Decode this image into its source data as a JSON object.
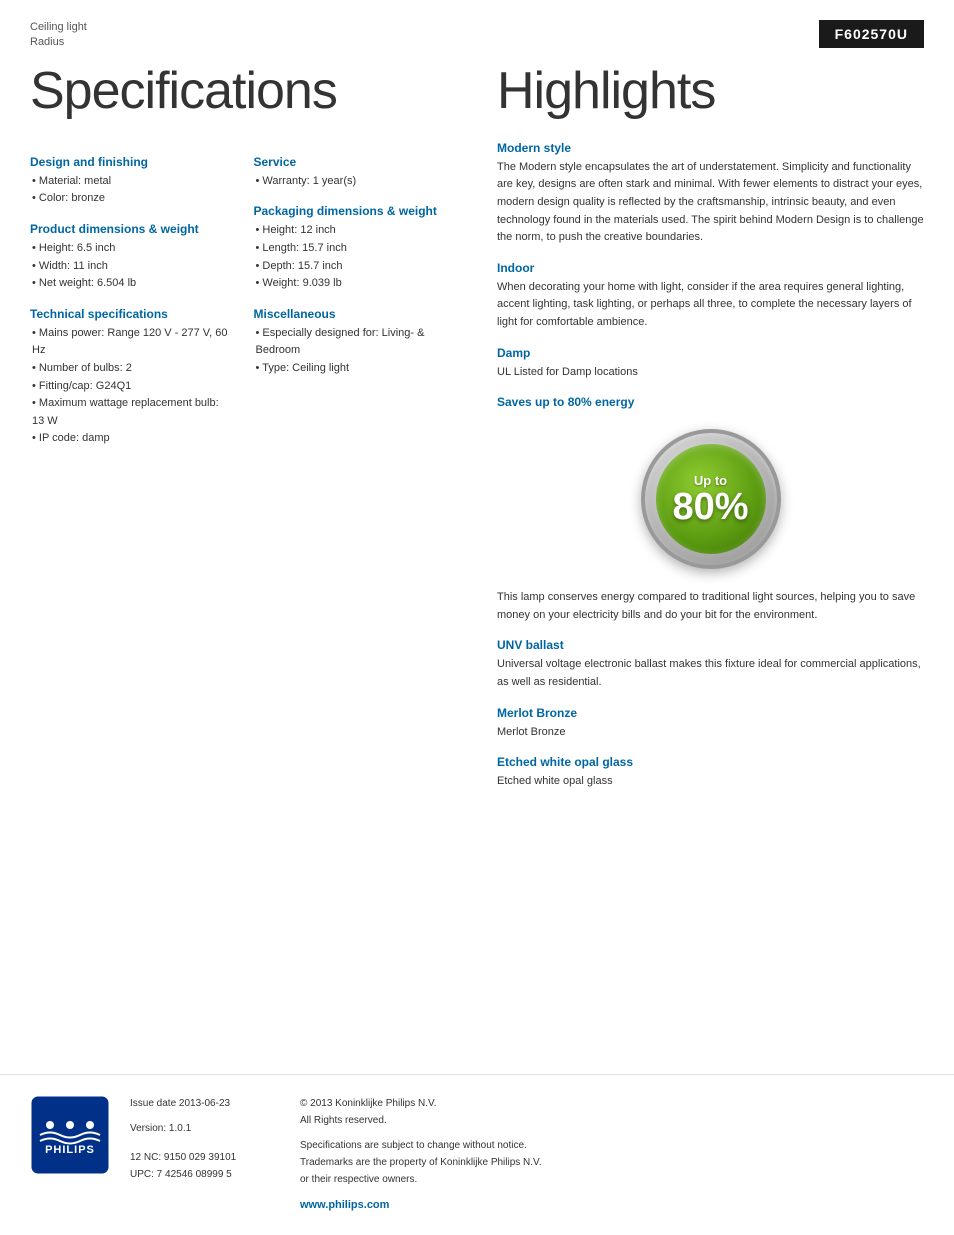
{
  "header": {
    "product_type": "Ceiling light",
    "product_name": "Radius",
    "product_code": "F602570U"
  },
  "specs_title": "Specifications",
  "highlights_title": "Highlights",
  "sections": {
    "design_finishing": {
      "heading": "Design and finishing",
      "items": [
        "Material: metal",
        "Color: bronze"
      ]
    },
    "product_dimensions": {
      "heading": "Product dimensions & weight",
      "items": [
        "Height: 6.5 inch",
        "Width: 11 inch",
        "Net weight: 6.504 lb"
      ]
    },
    "technical_specifications": {
      "heading": "Technical specifications",
      "items": [
        "Mains power: Range 120 V - 277 V, 60 Hz",
        "Number of bulbs: 2",
        "Fitting/cap: G24Q1",
        "Maximum wattage replacement bulb: 13 W",
        "IP code: damp"
      ]
    },
    "service": {
      "heading": "Service",
      "items": [
        "Warranty: 1 year(s)"
      ]
    },
    "packaging_dimensions": {
      "heading": "Packaging dimensions & weight",
      "items": [
        "Height: 12 inch",
        "Length: 15.7 inch",
        "Depth: 15.7 inch",
        "Weight: 9.039 lb"
      ]
    },
    "miscellaneous": {
      "heading": "Miscellaneous",
      "items": [
        "Especially designed for: Living- & Bedroom",
        "Type: Ceiling light"
      ]
    }
  },
  "highlights": {
    "modern_style": {
      "heading": "Modern style",
      "text": "The Modern style encapsulates the art of understatement. Simplicity and functionality are key, designs are often stark and minimal. With fewer elements to distract your eyes, modern design quality is reflected by the craftsmanship, intrinsic beauty, and even technology found in the materials used. The spirit behind Modern Design is to challenge the norm, to push the creative boundaries."
    },
    "indoor": {
      "heading": "Indoor",
      "text": "When decorating your home with light, consider if the area requires general lighting, accent lighting, task lighting, or perhaps all three, to complete the necessary layers of light for comfortable ambience."
    },
    "damp": {
      "heading": "Damp",
      "text": "UL Listed for Damp locations"
    },
    "saves_energy": {
      "heading": "Saves up to 80% energy",
      "badge_up_to": "Up to",
      "badge_percent": "80%"
    },
    "energy_text": "This lamp conserves energy compared to traditional light sources, helping you to save money on your electricity bills and do your bit for the environment.",
    "unv_ballast": {
      "heading": "UNV ballast",
      "text": "Universal voltage electronic ballast makes this fixture ideal for commercial applications, as well as residential."
    },
    "merlot_bronze": {
      "heading": "Merlot Bronze",
      "text": "Merlot Bronze"
    },
    "etched_glass": {
      "heading": "Etched white opal glass",
      "text": "Etched white opal glass"
    }
  },
  "footer": {
    "issue_date_label": "Issue date 2013-06-23",
    "version_label": "Version: 1.0.1",
    "nc_upc": "12 NC: 9150 029 39101\nUPC: 7 42546 08999 5",
    "copyright": "© 2013 Koninklijke Philips N.V.\nAll Rights reserved.",
    "disclaimer": "Specifications are subject to change without notice.\nTrademarks are the property of Koninklijke Philips N.V.\nor their respective owners.",
    "website": "www.philips.com"
  }
}
